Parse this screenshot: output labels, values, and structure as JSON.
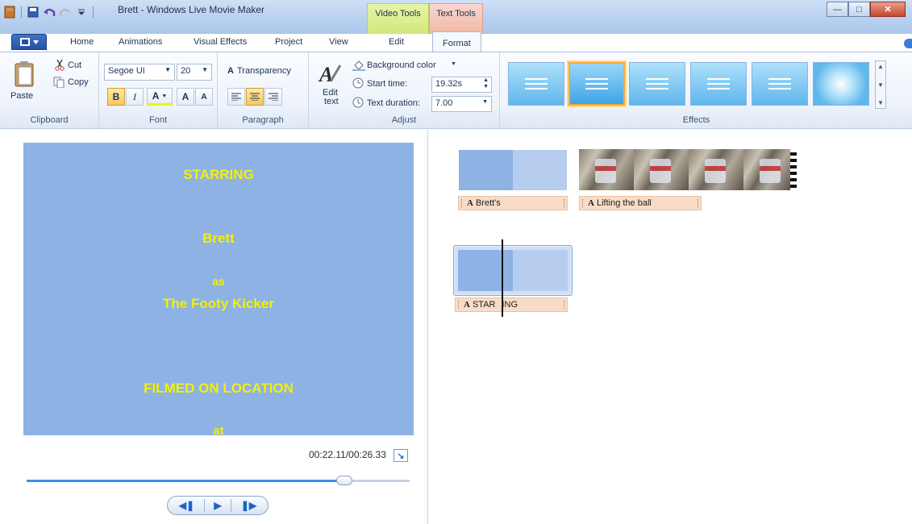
{
  "window": {
    "title": "Brett - Windows Live Movie Maker",
    "context_video_tools": "Video Tools",
    "context_text_tools": "Text Tools"
  },
  "tabs": {
    "home": "Home",
    "animations": "Animations",
    "visual_effects": "Visual Effects",
    "project": "Project",
    "view": "View",
    "edit": "Edit",
    "format": "Format"
  },
  "ribbon": {
    "clipboard": {
      "paste": "Paste",
      "cut": "Cut",
      "copy": "Copy",
      "label": "Clipboard"
    },
    "font": {
      "family": "Segoe UI",
      "size": "20",
      "bold": "B",
      "italic": "I",
      "color": "A",
      "grow": "A",
      "shrink": "A",
      "label": "Font"
    },
    "paragraph": {
      "transparency": "Transparency",
      "label": "Paragraph"
    },
    "adjust": {
      "edit_text_1": "Edit",
      "edit_text_2": "text",
      "background_color": "Background color",
      "start_time_label": "Start time:",
      "start_time_value": "19.32s",
      "text_duration_label": "Text duration:",
      "text_duration_value": "7.00",
      "label": "Adjust"
    },
    "effects": {
      "label": "Effects"
    }
  },
  "preview": {
    "lines": [
      "STARRING",
      "Brett",
      "as",
      "The Footy Kicker",
      "FILMED ON LOCATION",
      "at"
    ],
    "timecode": "00:22.11/00:26.33",
    "seek_progress": 0.83
  },
  "storyboard": {
    "captions": {
      "first": "Brett's",
      "second": "Lifting the ball",
      "third_a": "STAR",
      "third_b": "ING"
    },
    "caption_glyph": "A"
  },
  "colors": {
    "preview_bg": "#8eb2e4",
    "title_text": "#f6f000",
    "caption_bg": "#f8dcc7",
    "accent": "#3e8ee8"
  },
  "icons": [
    "app-icon",
    "save-icon",
    "undo-icon",
    "redo-icon",
    "paste-icon",
    "cut-icon",
    "copy-icon",
    "transparency-icon",
    "edit-text-icon",
    "paint-bucket-icon",
    "clock-icon",
    "timer-icon",
    "expand-icon",
    "previous-frame-icon",
    "play-icon",
    "next-frame-icon"
  ]
}
